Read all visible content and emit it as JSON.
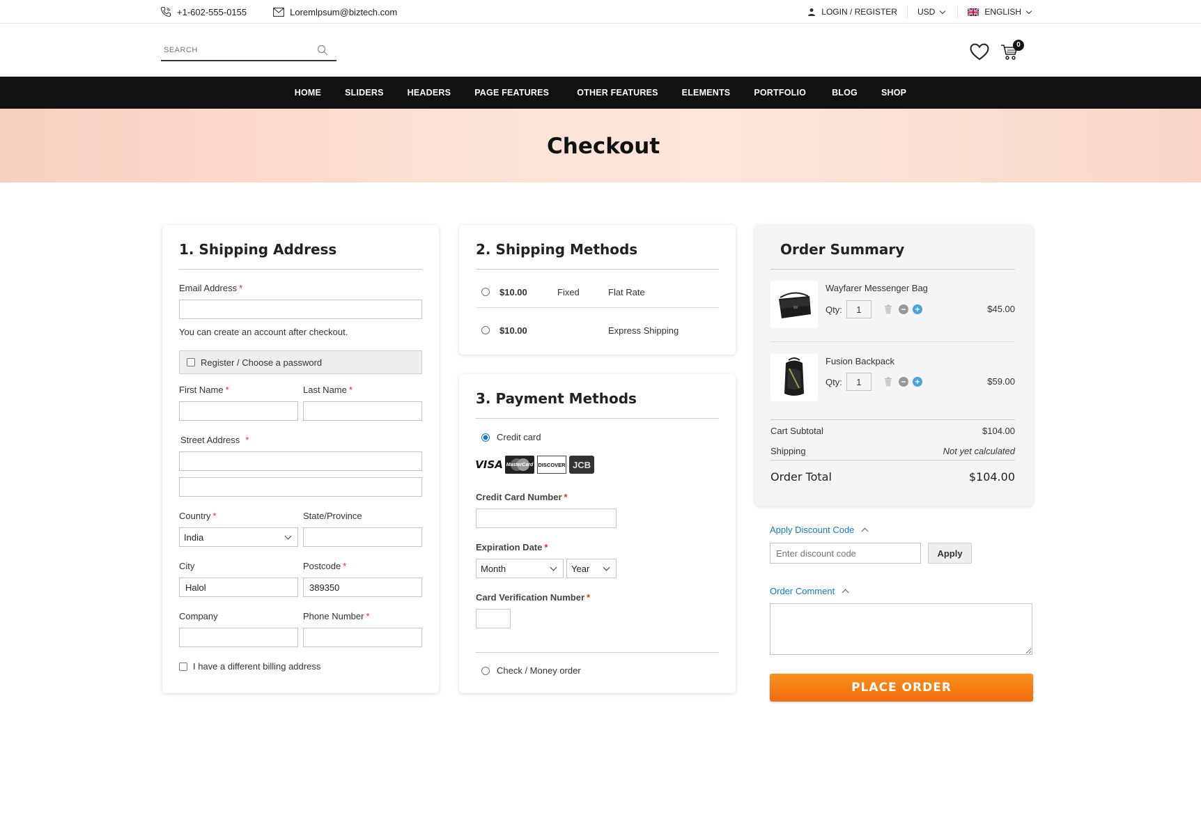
{
  "topbar": {
    "phone": "+1-602-555-0155",
    "email": "Loremlpsum@biztech.com",
    "login": "LOGIN / REGISTER",
    "currency": "USD",
    "language": "ENGLISH"
  },
  "header": {
    "search_placeholder": "SEARCH",
    "cart_count": "0"
  },
  "nav": {
    "items": [
      "HOME",
      "SLIDERS",
      "HEADERS",
      "PAGE FEATURES",
      "OTHER FEATURES",
      "ELEMENTS",
      "PORTFOLIO",
      "BLOG",
      "SHOP"
    ]
  },
  "banner": {
    "title": "Checkout"
  },
  "shipping_address": {
    "title": "1. Shipping Address",
    "email_label": "Email Address",
    "email_value": "",
    "account_note": "You can create an account after checkout.",
    "register_label": "Register / Choose a password",
    "first_name_label": "First Name",
    "last_name_label": "Last Name",
    "street_label": "Street Address",
    "country_label": "Country",
    "country_value": "India",
    "state_label": "State/Province",
    "city_label": "City",
    "city_value": "Halol",
    "postcode_label": "Postcode",
    "postcode_value": "389350",
    "company_label": "Company",
    "phone_label": "Phone Number",
    "billing_label": "I have a different billing address"
  },
  "shipping_methods": {
    "title": "2. Shipping Methods",
    "options": [
      {
        "price": "$10.00",
        "type": "Fixed",
        "name": "Flat Rate"
      },
      {
        "price": "$10.00",
        "type": "",
        "name": "Express Shipping"
      }
    ]
  },
  "payment_methods": {
    "title": "3. Payment Methods",
    "credit_card_label": "Credit card",
    "card_brands": [
      "VISA",
      "MasterCard",
      "DISCOVER",
      "JCB"
    ],
    "cc_number_label": "Credit Card Number",
    "expiry_label": "Expiration Date",
    "month_value": "Month",
    "year_value": "Year",
    "cvv_label": "Card Verification Number",
    "check_label": "Check / Money order"
  },
  "order_summary": {
    "title": "Order Summary",
    "items": [
      {
        "name": "Wayfarer Messenger Bag",
        "qty_label": "Qty:",
        "qty": "1",
        "price": "$45.00"
      },
      {
        "name": "Fusion Backpack",
        "qty_label": "Qty:",
        "qty": "1",
        "price": "$59.00"
      }
    ],
    "subtotal_label": "Cart Subtotal",
    "subtotal_value": "$104.00",
    "shipping_label": "Shipping",
    "shipping_value": "Not yet calculated",
    "total_label": "Order Total",
    "total_value": "$104.00"
  },
  "discount": {
    "toggle_label": "Apply Discount Code",
    "placeholder": "Enter discount code",
    "apply_label": "Apply"
  },
  "comment": {
    "toggle_label": "Order Comment"
  },
  "place_order": {
    "label": "PLACE ORDER"
  }
}
